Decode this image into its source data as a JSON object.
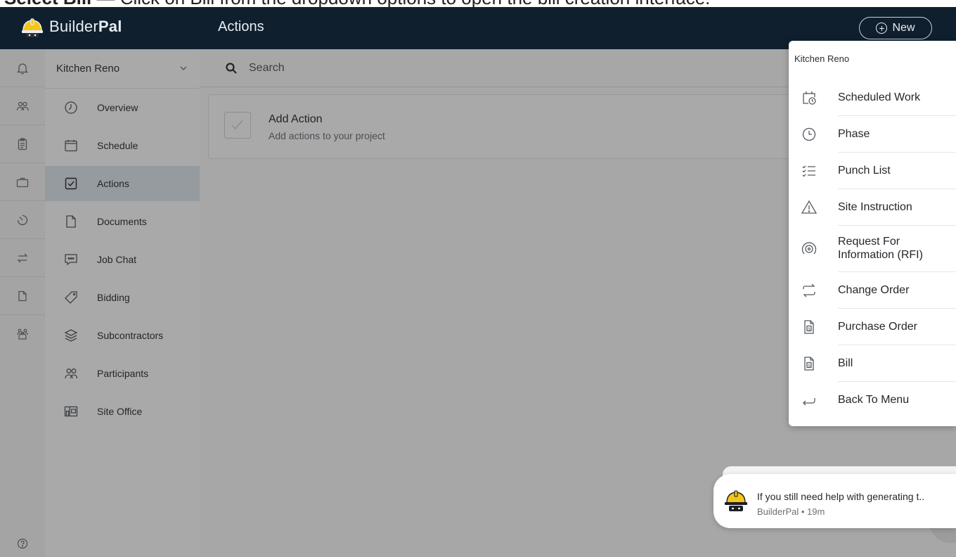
{
  "caption": {
    "strong": "Select Bill",
    "rest": " — Click on Bill from the dropdown options to open the bill creation interface."
  },
  "app": {
    "brand_light": "Builder",
    "brand_bold": "Pal",
    "page_title": "Actions",
    "new_button": "New"
  },
  "rail": {
    "icons": [
      "bell-icon",
      "people-icon",
      "clipboard-icon",
      "briefcase-icon",
      "timer-icon",
      "swap-icon",
      "document-icon",
      "group-icon"
    ],
    "help_icon": "help-icon"
  },
  "nav": {
    "project": "Kitchen Reno",
    "items": [
      {
        "label": "Overview",
        "icon": "clock-icon"
      },
      {
        "label": "Schedule",
        "icon": "calendar-icon"
      },
      {
        "label": "Actions",
        "icon": "checkbox-icon",
        "active": true
      },
      {
        "label": "Documents",
        "icon": "document-icon"
      },
      {
        "label": "Job Chat",
        "icon": "chat-icon"
      },
      {
        "label": "Bidding",
        "icon": "tag-icon"
      },
      {
        "label": "Subcontractors",
        "icon": "layers-icon"
      },
      {
        "label": "Participants",
        "icon": "people-icon"
      },
      {
        "label": "Site Office",
        "icon": "site-office-icon"
      }
    ]
  },
  "search": {
    "placeholder": "Search"
  },
  "card": {
    "title": "Add Action",
    "subtitle": "Add actions to your project"
  },
  "dropdown": {
    "header": "Kitchen Reno",
    "items": [
      {
        "label": "Scheduled Work",
        "icon": "calendar-clock-icon"
      },
      {
        "label": "Phase",
        "icon": "clock-icon"
      },
      {
        "label": "Punch List",
        "icon": "checklist-icon"
      },
      {
        "label": "Site Instruction",
        "icon": "warning-icon"
      },
      {
        "label": "Request For Information (RFI)",
        "icon": "broadcast-icon"
      },
      {
        "label": "Change Order",
        "icon": "swap-icon"
      },
      {
        "label": "Purchase Order",
        "icon": "dollar-document-icon"
      },
      {
        "label": "Bill",
        "icon": "dollar-document-icon"
      },
      {
        "label": "Back To Menu",
        "icon": "back-arrow-icon"
      }
    ]
  },
  "toast": {
    "message": "If you still need help with generating t..",
    "meta": "BuilderPal • 19m"
  },
  "colors": {
    "topbar": "#0f1f2e",
    "overlay": "#a7a7a7",
    "dropdown_bg": "#ffffff",
    "accent_helmet": "#f5c518"
  }
}
